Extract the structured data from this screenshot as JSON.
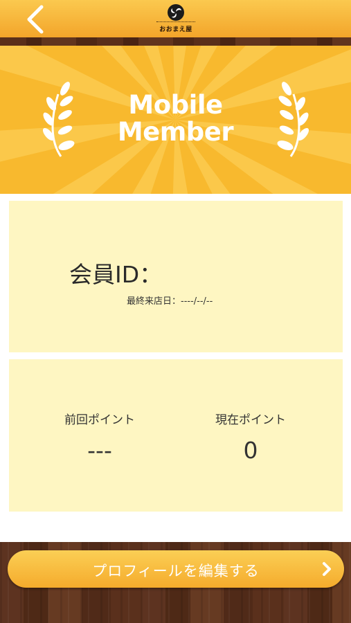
{
  "header": {
    "back_icon": "chevron-left-icon",
    "logo_icon": "tomoe-crest-icon",
    "logo_name": "おおまえ屋"
  },
  "banner": {
    "title_line1": "Mobile",
    "title_line2": "Member",
    "left_icon": "laurel-branch-icon",
    "right_icon": "laurel-branch-icon"
  },
  "member": {
    "id_label": "会員ID：",
    "id_value": "",
    "last_visit_label": "最終来店日：",
    "last_visit_value": "----/--/--"
  },
  "points": {
    "previous_label": "前回ポイント",
    "previous_value": "---",
    "current_label": "現在ポイント",
    "current_value": "0"
  },
  "actions": {
    "edit_profile_label": "プロフィールを編集する",
    "edit_profile_icon": "chevron-right-icon"
  },
  "colors": {
    "header_orange": "#f5ab2c",
    "banner_yellow": "#f8b92e",
    "card_cream": "#fef6c2",
    "wood_brown": "#5a301c",
    "button_orange": "#f5ab2c"
  }
}
